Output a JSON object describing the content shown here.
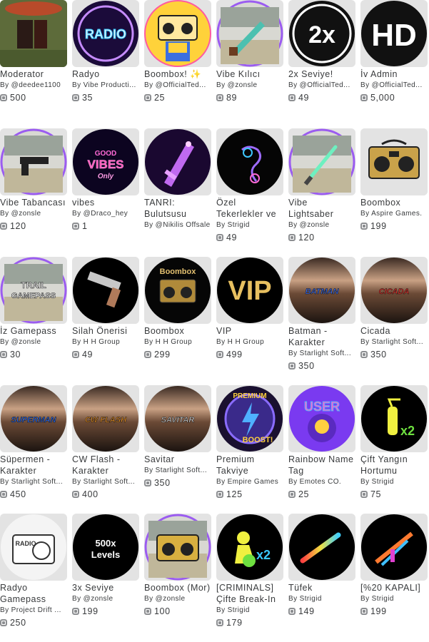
{
  "items": [
    {
      "name": "Moderator",
      "by_prefix": "By ",
      "creator": "@deedee1100",
      "price": "500",
      "thumb": "moderator"
    },
    {
      "name": "Radyo",
      "by_prefix": "By ",
      "creator": "Vibe Producti...",
      "price": "35",
      "thumb": "radio"
    },
    {
      "name": "Boombox! ✨",
      "by_prefix": "By ",
      "creator": "@OfficialTed...",
      "price": "25",
      "thumb": "boombox-rainbow"
    },
    {
      "name": "Vibe Kılıcı",
      "by_prefix": "By ",
      "creator": "@zonsle",
      "price": "89",
      "thumb": "sword"
    },
    {
      "name": "2x Seviye!",
      "by_prefix": "By ",
      "creator": "@OfficialTed...",
      "price": "49",
      "thumb": "2x"
    },
    {
      "name": "İv Admin",
      "by_prefix": "By ",
      "creator": "@OfficialTed...",
      "price": "5,000",
      "thumb": "hd"
    },
    {
      "name": "Vibe Tabancası",
      "by_prefix": "By ",
      "creator": "@zonsle",
      "price": "120",
      "thumb": "gun-purple"
    },
    {
      "name": "vibes",
      "by_prefix": "By ",
      "creator": "@Draco_hey",
      "price": "1",
      "thumb": "good-vibes"
    },
    {
      "name": "TANRI: Bulutsusu",
      "by_prefix": "By ",
      "creator": "@Nikilis Offsale",
      "price": "",
      "thumb": "nebula-sword"
    },
    {
      "name": "Özel Tekerlekler ve",
      "by_prefix": "By ",
      "creator": "Strigid",
      "price": "49",
      "thumb": "wheels"
    },
    {
      "name": "Vibe Lightsaber",
      "by_prefix": "By ",
      "creator": "@zonsle",
      "price": "120",
      "thumb": "lightsaber"
    },
    {
      "name": "Boombox",
      "by_prefix": "By ",
      "creator": "Aspire Games.",
      "price": "199",
      "thumb": "boombox-gold"
    },
    {
      "name": "İz Gamepass",
      "by_prefix": "By ",
      "creator": "@zonsle",
      "price": "30",
      "thumb": "trail"
    },
    {
      "name": "Silah Önerisi",
      "by_prefix": "By ",
      "creator": "H H Group",
      "price": "49",
      "thumb": "pistol"
    },
    {
      "name": "Boombox",
      "by_prefix": "By ",
      "creator": "H H Group",
      "price": "299",
      "thumb": "boombox-dark"
    },
    {
      "name": "VIP",
      "by_prefix": "By ",
      "creator": "H H Group",
      "price": "499",
      "thumb": "vip"
    },
    {
      "name": "Batman - Karakter",
      "by_prefix": "By ",
      "creator": "Starlight Soft...",
      "price": "350",
      "thumb": "batman"
    },
    {
      "name": "Cicada",
      "by_prefix": "By ",
      "creator": "Starlight Soft...",
      "price": "350",
      "thumb": "cicada"
    },
    {
      "name": "Süpermen - Karakter",
      "by_prefix": "By ",
      "creator": "Starlight Soft...",
      "price": "450",
      "thumb": "superman"
    },
    {
      "name": "CW Flash - Karakter",
      "by_prefix": "By ",
      "creator": "Starlight Soft...",
      "price": "400",
      "thumb": "flash"
    },
    {
      "name": "Savitar",
      "by_prefix": "By ",
      "creator": "Starlight Soft...",
      "price": "350",
      "thumb": "savitar"
    },
    {
      "name": "Premium Takviye",
      "by_prefix": "By ",
      "creator": "Empire Games",
      "price": "125",
      "thumb": "premium"
    },
    {
      "name": "Rainbow Name Tag",
      "by_prefix": "By ",
      "creator": "Emotes CO.",
      "price": "25",
      "thumb": "user-tag"
    },
    {
      "name": "Çift Yangın Hortumu",
      "by_prefix": "By ",
      "creator": "Strigid",
      "price": "75",
      "thumb": "extinguisher"
    },
    {
      "name": "Radyo Gamepass",
      "by_prefix": "By ",
      "creator": "Project Drift ...",
      "price": "250",
      "thumb": "radio-sketch"
    },
    {
      "name": "3x Seviye",
      "by_prefix": "By ",
      "creator": "@zonsle",
      "price": "199",
      "thumb": "500x"
    },
    {
      "name": "Boombox (Mor)",
      "by_prefix": "By ",
      "creator": "@zonsle",
      "price": "100",
      "thumb": "boombox-mor"
    },
    {
      "name": "[CRIMINALS] Çifte Break-In",
      "by_prefix": "By ",
      "creator": "Strigid",
      "price": "179",
      "thumb": "criminals"
    },
    {
      "name": "Tüfek",
      "by_prefix": "By ",
      "creator": "Strigid",
      "price": "149",
      "thumb": "shotgun"
    },
    {
      "name": "[%20 KAPALI]",
      "by_prefix": "By ",
      "creator": "Strigid",
      "price": "199",
      "thumb": "rifle"
    }
  ],
  "thumb_text": {
    "radio": "RADIO",
    "2x": "2x",
    "hd": "HD",
    "good-vibes-1": "GOOD",
    "good-vibes-2": "VIBES",
    "good-vibes-3": "Only",
    "trail-1": "TRAIL",
    "trail-2": "GAMEPASS",
    "boombox-dark": "Boombox",
    "vip": "VIP",
    "batman": "BATMAN",
    "cicada": "CICADA",
    "superman": "SUPERMAN",
    "flash": "CW FLASH",
    "savitar": "SAVITAR",
    "premium-1": "PREMIUM",
    "premium-2": "BOOST!",
    "user": "USER",
    "x2": "x2",
    "radio-sketch": "RADIO",
    "500x-1": "500x",
    "500x-2": "Levels",
    "criminals-x2": "x2"
  }
}
